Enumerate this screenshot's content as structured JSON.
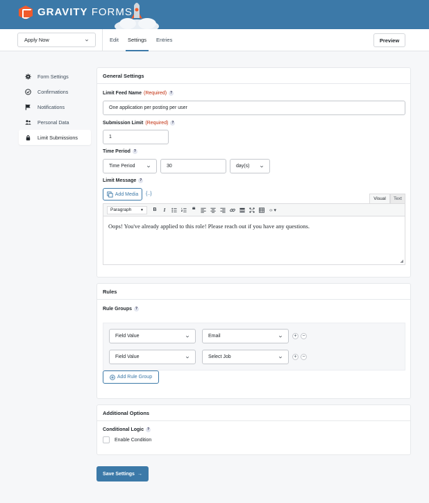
{
  "header": {
    "brand_strong": "GRAVITY",
    "brand_light": " FORMS",
    "colors": {
      "topbar": "#3c79a8",
      "logo": "#f15a2b"
    }
  },
  "nav": {
    "form_select_value": "Apply Now",
    "tabs": [
      {
        "label": "Edit",
        "active": false
      },
      {
        "label": "Settings",
        "active": true
      },
      {
        "label": "Entries",
        "active": false
      }
    ],
    "preview_label": "Preview"
  },
  "sidebar": {
    "items": [
      {
        "label": "Form Settings",
        "icon": "gear-icon"
      },
      {
        "label": "Confirmations",
        "icon": "check-circle-icon"
      },
      {
        "label": "Notifications",
        "icon": "flag-icon"
      },
      {
        "label": "Personal Data",
        "icon": "users-icon"
      },
      {
        "label": "Limit Submissions",
        "icon": "lock-icon",
        "active": true
      }
    ]
  },
  "general": {
    "title": "General Settings",
    "feed_name_label": "Limit Feed Name",
    "required": "(Required)",
    "feed_name_value": "One application per posting per user",
    "submission_limit_label": "Submission Limit",
    "submission_limit_value": "1",
    "time_period_label": "Time Period",
    "time_period_select": "Time Period",
    "time_period_value": "30",
    "time_unit": "day(s)",
    "limit_message_label": "Limit Message",
    "add_media": "Add Media",
    "merge_tag": "{..}",
    "visual_tab": "Visual",
    "text_tab": "Text",
    "paragraph": "Paragraph",
    "message": "Oops! You've already applied to this role! Please reach out if you have any questions."
  },
  "rules": {
    "title": "Rules",
    "groups_label": "Rule Groups",
    "rows": [
      {
        "field": "Field Value",
        "value": "Email"
      },
      {
        "field": "Field Value",
        "value": "Select Job"
      }
    ],
    "add_group": "Add Rule Group"
  },
  "additional": {
    "title": "Additional Options",
    "conditional_label": "Conditional Logic",
    "enable_label": "Enable Condition"
  },
  "save_label": "Save Settings"
}
